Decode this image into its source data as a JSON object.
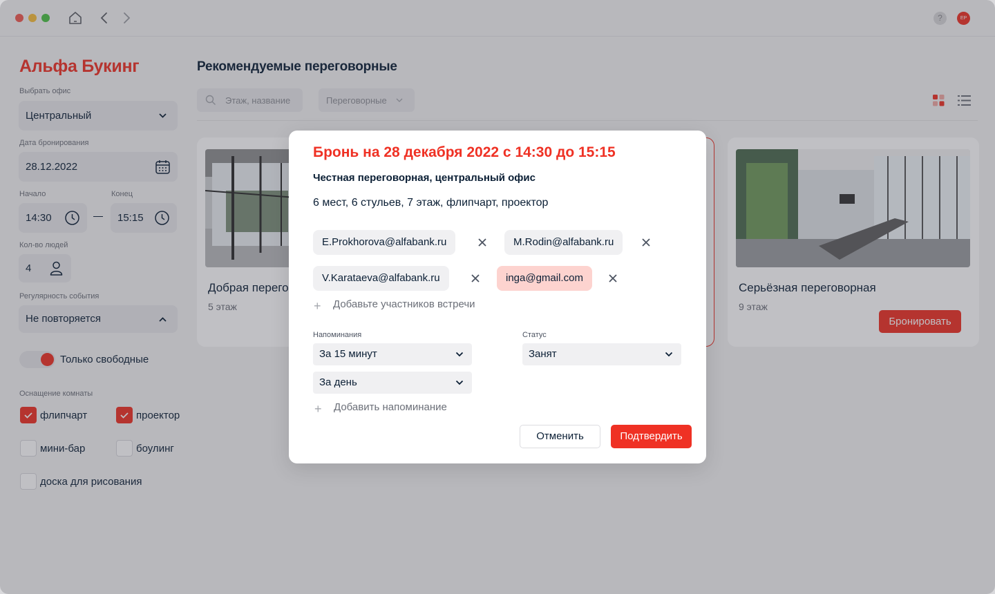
{
  "header": {
    "help_label": "?",
    "avatar_initials": "EP"
  },
  "sidebar": {
    "brand": "Альфа Букинг",
    "office": {
      "label": "Выбрать офис",
      "value": "Центральный"
    },
    "date": {
      "label": "Дата бронирования",
      "value": "28.12.2022"
    },
    "start": {
      "label": "Начало",
      "value": "14:30"
    },
    "end": {
      "label": "Конец",
      "value": "15:15"
    },
    "people": {
      "label": "Кол-во людей",
      "value": "4"
    },
    "regularity": {
      "label": "Регулярность события",
      "value": "Не повторяется"
    },
    "only_free": {
      "label": "Только свободные",
      "on": true
    },
    "equipment": {
      "label": "Оснащение комнаты",
      "items": [
        {
          "label": "флипчарт",
          "checked": true
        },
        {
          "label": "проектор",
          "checked": true
        },
        {
          "label": "мини-бар",
          "checked": false
        },
        {
          "label": "боулинг",
          "checked": false
        },
        {
          "label": "доска для рисования",
          "checked": false
        }
      ]
    }
  },
  "main": {
    "title": "Рекомендуемые переговорные",
    "search_placeholder": "Этаж, название",
    "filter_label": "Переговорные",
    "rooms": [
      {
        "name": "Добрая переговорная",
        "floor": "5 этаж"
      },
      {
        "name": "Серьёзная переговорная",
        "floor": "9 этаж",
        "button": "Бронировать"
      }
    ]
  },
  "modal": {
    "title": "Бронь на 28 декабря 2022 с 14:30 до 15:15",
    "subtitle": "Честная переговорная, центральный офис",
    "description": "6 мест,  6 стульев, 7 этаж, флипчарт, проектор",
    "participants": [
      {
        "email": "E.Prokhorova@alfabank.ru",
        "invalid": false
      },
      {
        "email": "M.Rodin@alfabank.ru",
        "invalid": false
      },
      {
        "email": "V.Karataeva@alfabank.ru",
        "invalid": false
      },
      {
        "email": "inga@gmail.com",
        "invalid": true
      }
    ],
    "add_participants": "Добавьте участников встречи",
    "reminders_label": "Напоминания",
    "reminders": [
      "За 15 минут",
      "За день"
    ],
    "add_reminder": "Добавить напоминание",
    "status_label": "Статус",
    "status_value": "Занят",
    "cancel": "Отменить",
    "confirm": "Подтвердить"
  },
  "colors": {
    "accent": "#ef3124",
    "text": "#0b1f35",
    "chip_error": "#fdd3cf"
  }
}
